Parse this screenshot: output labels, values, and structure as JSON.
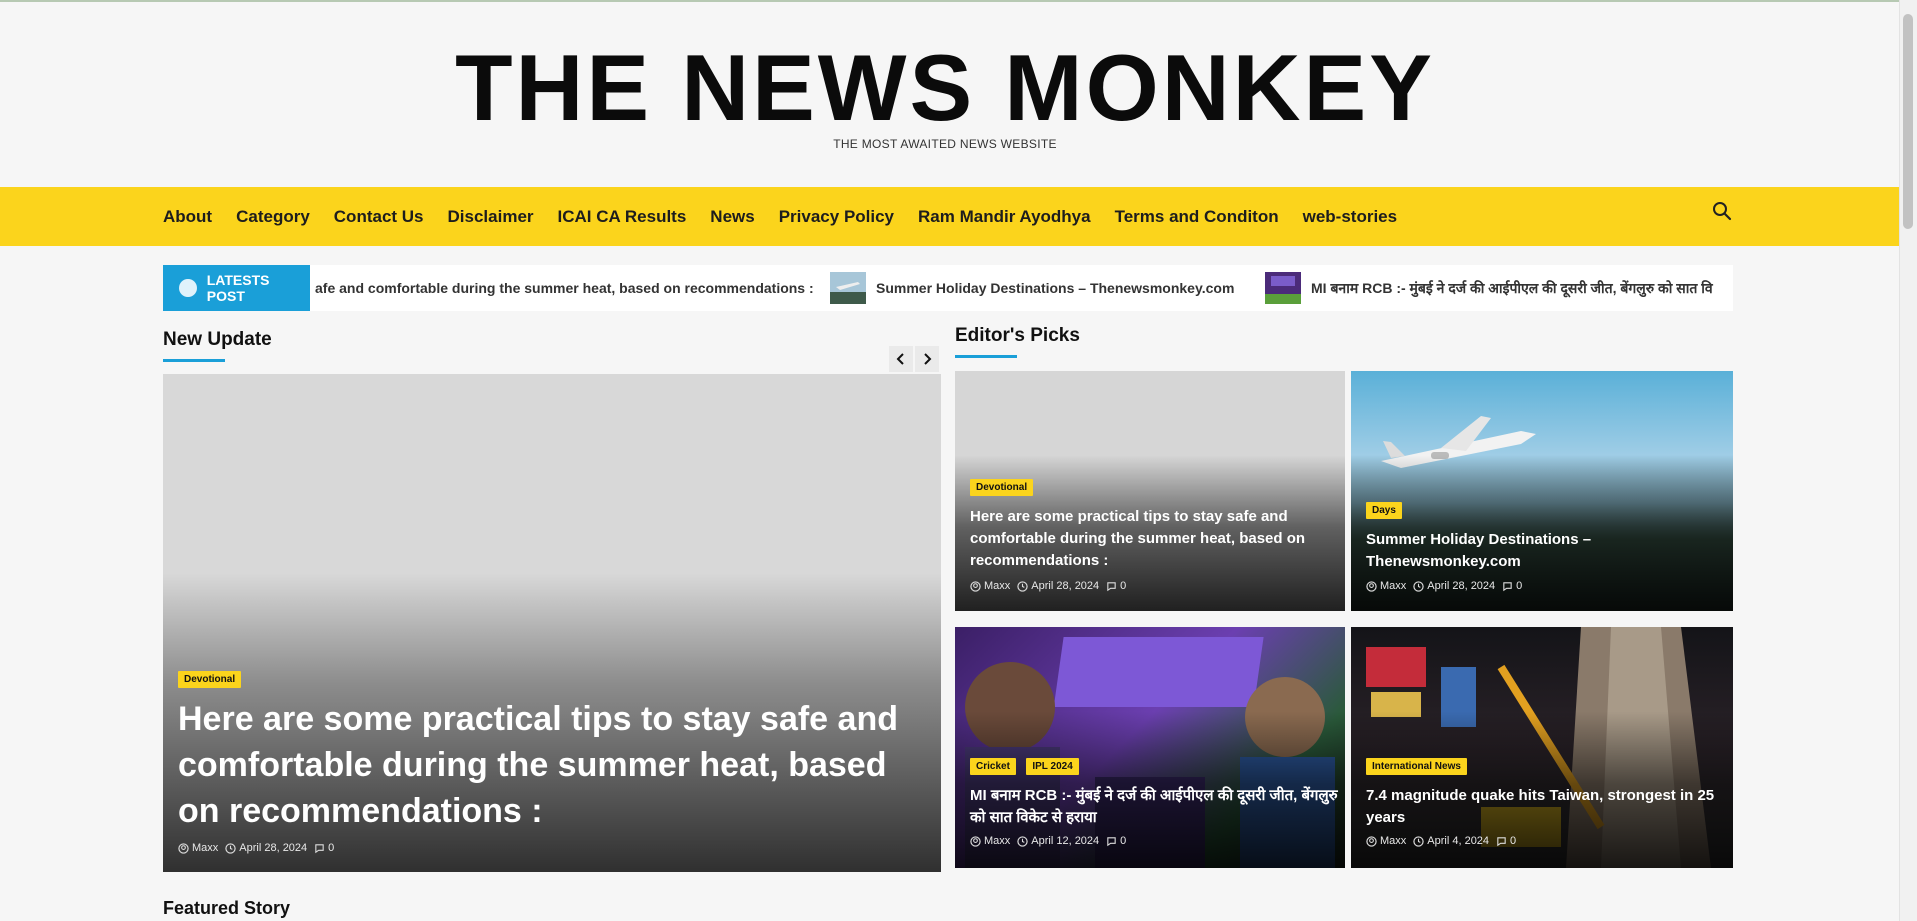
{
  "site": {
    "title": "THE NEWS MONKEY",
    "tagline": "THE MOST AWAITED NEWS WEBSITE"
  },
  "nav": {
    "items": [
      "About",
      "Category",
      "Contact Us",
      "Disclaimer",
      "ICAI CA Results",
      "News",
      "Privacy Policy",
      "Ram Mandir Ayodhya",
      "Terms and Conditon",
      "web-stories"
    ],
    "search_icon": "search-icon"
  },
  "ticker": {
    "label": "LATESTS POST",
    "items": [
      "afe and comfortable during the summer heat, based on recommendations :",
      "Summer Holiday Destinations – Thenewsmonkey.com",
      "MI बनाम RCB :- मुंबई ने दर्ज की आईपीएल की दूसरी जीत, बेंगलुरु को सात वि"
    ]
  },
  "new_update": {
    "heading": "New Update",
    "hero": {
      "category": "Devotional",
      "title": "Here are some practical tips to stay safe and comfortable during the summer heat, based on recommendations :",
      "author": "Maxx",
      "date": "April 28, 2024",
      "comments": "0"
    }
  },
  "editors_picks": {
    "heading": "Editor's Picks",
    "cards": [
      {
        "categories": [
          "Devotional"
        ],
        "title": "Here are some practical tips to stay safe and comfortable during the summer heat, based on recommendations :",
        "author": "Maxx",
        "date": "April 28, 2024",
        "comments": "0"
      },
      {
        "categories": [
          "Days"
        ],
        "title": "Summer Holiday Destinations – Thenewsmonkey.com",
        "author": "Maxx",
        "date": "April 28, 2024",
        "comments": "0"
      },
      {
        "categories": [
          "Cricket",
          "IPL 2024"
        ],
        "title": "MI बनाम RCB :- मुंबई ने दर्ज की आईपीएल की दूसरी जीत, बेंगलुरु को सात विकेट से हराया",
        "author": "Maxx",
        "date": "April 12, 2024",
        "comments": "0"
      },
      {
        "categories": [
          "International News"
        ],
        "title": "7.4 magnitude quake hits Taiwan, strongest in 25 years",
        "author": "Maxx",
        "date": "April 4, 2024",
        "comments": "0"
      }
    ]
  },
  "featured": {
    "heading": "Featured Story"
  },
  "colors": {
    "accent_yellow": "#fbd41c",
    "accent_blue": "#1a9fd8"
  }
}
